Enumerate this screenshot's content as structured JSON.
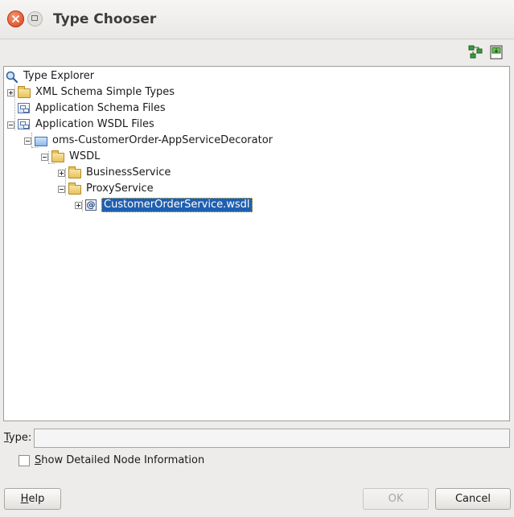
{
  "window": {
    "title": "Type Chooser"
  },
  "toolbar": {
    "icons": [
      "hierarchy-icon",
      "import-icon"
    ]
  },
  "tree": [
    {
      "label": "Type Explorer",
      "icon": "search-icon",
      "toggle": "none",
      "selected": false
    },
    {
      "label": "XML Schema Simple Types",
      "icon": "folder-icon",
      "toggle": "plus",
      "selected": false
    },
    {
      "label": "Application Schema Files",
      "icon": "schema-icon",
      "toggle": "none",
      "selected": false
    },
    {
      "label": "Application WSDL Files",
      "icon": "schema-icon",
      "toggle": "minus",
      "selected": false
    },
    {
      "label": "oms-CustomerOrder-AppServiceDecorator",
      "icon": "project-folder-icon",
      "toggle": "minus",
      "selected": false
    },
    {
      "label": "WSDL",
      "icon": "folder-icon",
      "toggle": "minus",
      "selected": false
    },
    {
      "label": "BusinessService",
      "icon": "folder-icon",
      "toggle": "plus",
      "selected": false
    },
    {
      "label": "ProxyService",
      "icon": "folder-icon",
      "toggle": "minus",
      "selected": false
    },
    {
      "label": "CustomerOrderService.wsdl",
      "icon": "wsdl-icon",
      "toggle": "plus",
      "selected": true
    }
  ],
  "type_field": {
    "label_mnemonic": "T",
    "label_rest": "ype:",
    "value": ""
  },
  "detail_checkbox": {
    "mnemonic": "S",
    "rest": "how Detailed Node Information",
    "checked": false
  },
  "buttons": {
    "help": {
      "mnemonic": "H",
      "rest": "elp"
    },
    "ok": "OK",
    "cancel": "Cancel"
  },
  "colors": {
    "selection": "#1f5fb0",
    "window_bg": "#edeceb"
  }
}
